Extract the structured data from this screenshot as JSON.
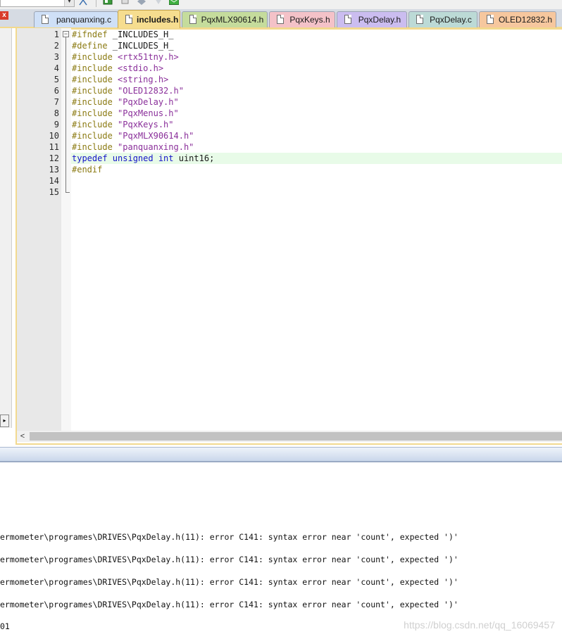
{
  "tabs": [
    {
      "label": "panquanxing.c",
      "color": "#cfe0f7"
    },
    {
      "label": "includes.h",
      "color": "#f6dd8f",
      "active": true
    },
    {
      "label": "PqxMLX90614.h",
      "color": "#c5dc9c"
    },
    {
      "label": "PqxKeys.h",
      "color": "#f4c2c8"
    },
    {
      "label": "PqxDelay.h",
      "color": "#cbbdf0"
    },
    {
      "label": "PqxDelay.c",
      "color": "#bcdad6"
    },
    {
      "label": "OLED12832.h",
      "color": "#f6c79e"
    }
  ],
  "toolbar": {
    "close_label": "x",
    "combo_arrow": "▾"
  },
  "editor": {
    "line_numbers": [
      "1",
      "2",
      "3",
      "4",
      "5",
      "6",
      "7",
      "8",
      "9",
      "10",
      "11",
      "12",
      "13",
      "14",
      "15"
    ],
    "highlighted_line": 12,
    "lines": [
      [
        {
          "t": "#ifndef",
          "c": "pp"
        },
        {
          "t": " _INCLUDES_H_",
          "c": "plain"
        }
      ],
      [
        {
          "t": "#define",
          "c": "pp"
        },
        {
          "t": " _INCLUDES_H_",
          "c": "plain"
        }
      ],
      [
        {
          "t": "#include ",
          "c": "pp"
        },
        {
          "t": "<rtx51tny.h>",
          "c": "str"
        }
      ],
      [
        {
          "t": "#include ",
          "c": "pp"
        },
        {
          "t": "<stdio.h>",
          "c": "str"
        }
      ],
      [
        {
          "t": "#include ",
          "c": "pp"
        },
        {
          "t": "<string.h>",
          "c": "str"
        }
      ],
      [
        {
          "t": "#include ",
          "c": "pp"
        },
        {
          "t": "\"OLED12832.h\"",
          "c": "str"
        }
      ],
      [
        {
          "t": "#include ",
          "c": "pp"
        },
        {
          "t": "\"PqxDelay.h\"",
          "c": "str"
        }
      ],
      [
        {
          "t": "#include ",
          "c": "pp"
        },
        {
          "t": "\"PqxMenus.h\"",
          "c": "str"
        }
      ],
      [
        {
          "t": "#include ",
          "c": "pp"
        },
        {
          "t": "\"PqxKeys.h\"",
          "c": "str"
        }
      ],
      [
        {
          "t": "#include ",
          "c": "pp"
        },
        {
          "t": "\"PqxMLX90614.h\"",
          "c": "str"
        }
      ],
      [
        {
          "t": "#include ",
          "c": "pp"
        },
        {
          "t": "\"panquanxing.h\"",
          "c": "str"
        }
      ],
      [
        {
          "t": "typedef ",
          "c": "kw"
        },
        {
          "t": "unsigned ",
          "c": "kw"
        },
        {
          "t": "int ",
          "c": "kw"
        },
        {
          "t": "uint16;",
          "c": "plain"
        }
      ],
      [
        {
          "t": "#endif",
          "c": "pp"
        }
      ],
      [],
      []
    ]
  },
  "scrollbar": {
    "left_arrow": "<",
    "side_arrow": "▸"
  },
  "output": {
    "lines": [
      "ermometer\\programes\\DRIVES\\PqxDelay.h(11): error C141: syntax error near 'count', expected ')'",
      "ermometer\\programes\\DRIVES\\PqxDelay.h(11): error C141: syntax error near 'count', expected ')'",
      "ermometer\\programes\\DRIVES\\PqxDelay.h(11): error C141: syntax error near 'count', expected ')'",
      "ermometer\\programes\\DRIVES\\PqxDelay.h(11): error C141: syntax error near 'count', expected ')'"
    ],
    "last_line": "01"
  },
  "watermark": "https://blog.csdn.net/qq_16069457"
}
